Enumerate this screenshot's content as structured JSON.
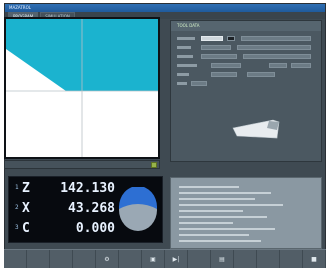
{
  "window": {
    "title": "MAZATROL"
  },
  "tabs": [
    {
      "label": "PROGRAM",
      "active": true
    },
    {
      "label": "SIMULATION",
      "active": false
    }
  ],
  "graph": {
    "background": "#ffffff",
    "material_color": "#1bb3cf",
    "grid_color": "#b9c0c6"
  },
  "dro": {
    "rows": [
      {
        "index": "1",
        "axis": "Z",
        "value": "142.130"
      },
      {
        "index": "2",
        "axis": "X",
        "value": "43.268"
      },
      {
        "index": "3",
        "axis": "C",
        "value": "0.000"
      }
    ],
    "gauge_colors": {
      "top": "#2d6fd3",
      "bottom": "#9aa8b4"
    }
  },
  "params": {
    "header": "TOOL DATA"
  },
  "softkeys": [
    {
      "icon": "blank-icon",
      "glyph": "",
      "label": ""
    },
    {
      "icon": "blank-icon",
      "glyph": "",
      "label": ""
    },
    {
      "icon": "blank-icon",
      "glyph": "",
      "label": ""
    },
    {
      "icon": "blank-icon",
      "glyph": "",
      "label": ""
    },
    {
      "icon": "tool-icon",
      "glyph": "⚙",
      "label": ""
    },
    {
      "icon": "blank-icon",
      "glyph": "",
      "label": ""
    },
    {
      "icon": "page-icon",
      "glyph": "▣",
      "label": ""
    },
    {
      "icon": "play-icon",
      "glyph": "▶|",
      "label": ""
    },
    {
      "icon": "blank-icon",
      "glyph": "",
      "label": ""
    },
    {
      "icon": "doc-icon",
      "glyph": "▤",
      "label": ""
    },
    {
      "icon": "blank-icon",
      "glyph": "",
      "label": ""
    },
    {
      "icon": "blank-icon",
      "glyph": "",
      "label": ""
    },
    {
      "icon": "blank-icon",
      "glyph": "",
      "label": ""
    },
    {
      "icon": "square-icon",
      "glyph": "■",
      "label": ""
    }
  ]
}
